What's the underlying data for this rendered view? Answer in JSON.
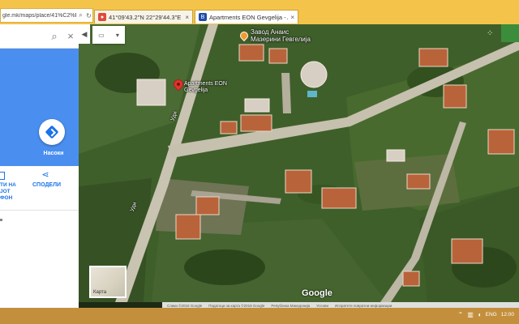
{
  "browser": {
    "address_text": "gle.mk/maps/place/41%C2%B00",
    "tabs": [
      {
        "title": "41°09'43.2\"N 22°29'44.3\"E - ...",
        "favicon": "map-pin-icon",
        "color": "#e04a3a"
      },
      {
        "title": "Apartments EON Gevgelija - A...",
        "favicon": "booking-icon",
        "color": "#1e4aa8"
      }
    ]
  },
  "sidebar": {
    "nav_label": "Насоки",
    "actions": [
      {
        "label": "ТИ НА\nЈОТ\nФОН",
        "icon": "send-to-phone-icon"
      },
      {
        "label": "СПОДЕЛИ",
        "icon": "share-icon"
      }
    ]
  },
  "map": {
    "labels": {
      "place_orange": "Завод Анаис\nМазерини Гевгелија",
      "place_red": "Apartments EON\nGevgelija",
      "road1": "Уди",
      "road2": "Уди"
    },
    "thumb_label": "Карта",
    "logo": "Google"
  },
  "attribution": {
    "items": [
      "Слики ©2018 Google",
      "Податоци за карта ©2018 Google",
      "Република Македонија",
      "Услови",
      "Испратете повратни информации"
    ]
  },
  "taskbar": {
    "lang": "ENG",
    "clock": "12:00"
  }
}
